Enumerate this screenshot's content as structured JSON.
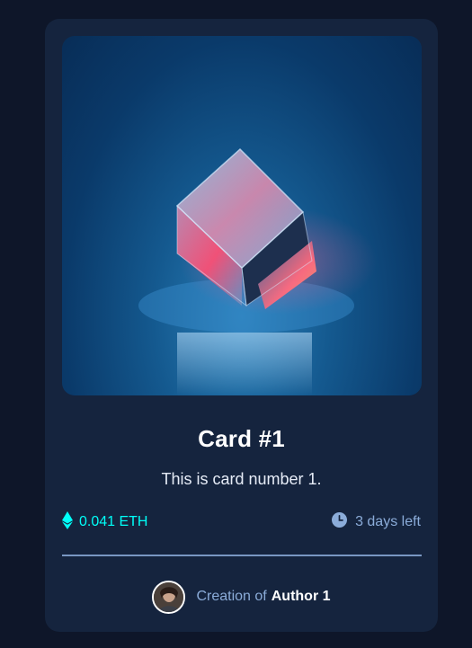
{
  "card": {
    "title": "Card #1",
    "description": "This is card number 1.",
    "price": "0.041 ETH",
    "time_left": "3 days left",
    "author_prefix": "Creation of",
    "author_name": "Author 1"
  },
  "icons": {
    "price": "ethereum-icon",
    "time": "clock-icon",
    "hero": "glass-cube-image",
    "avatar": "author-avatar"
  },
  "colors": {
    "page_bg": "#0e1629",
    "card_bg": "#15243e",
    "cyan": "#00fff8",
    "soft_blue": "#8bacd9",
    "white": "#ffffff"
  }
}
